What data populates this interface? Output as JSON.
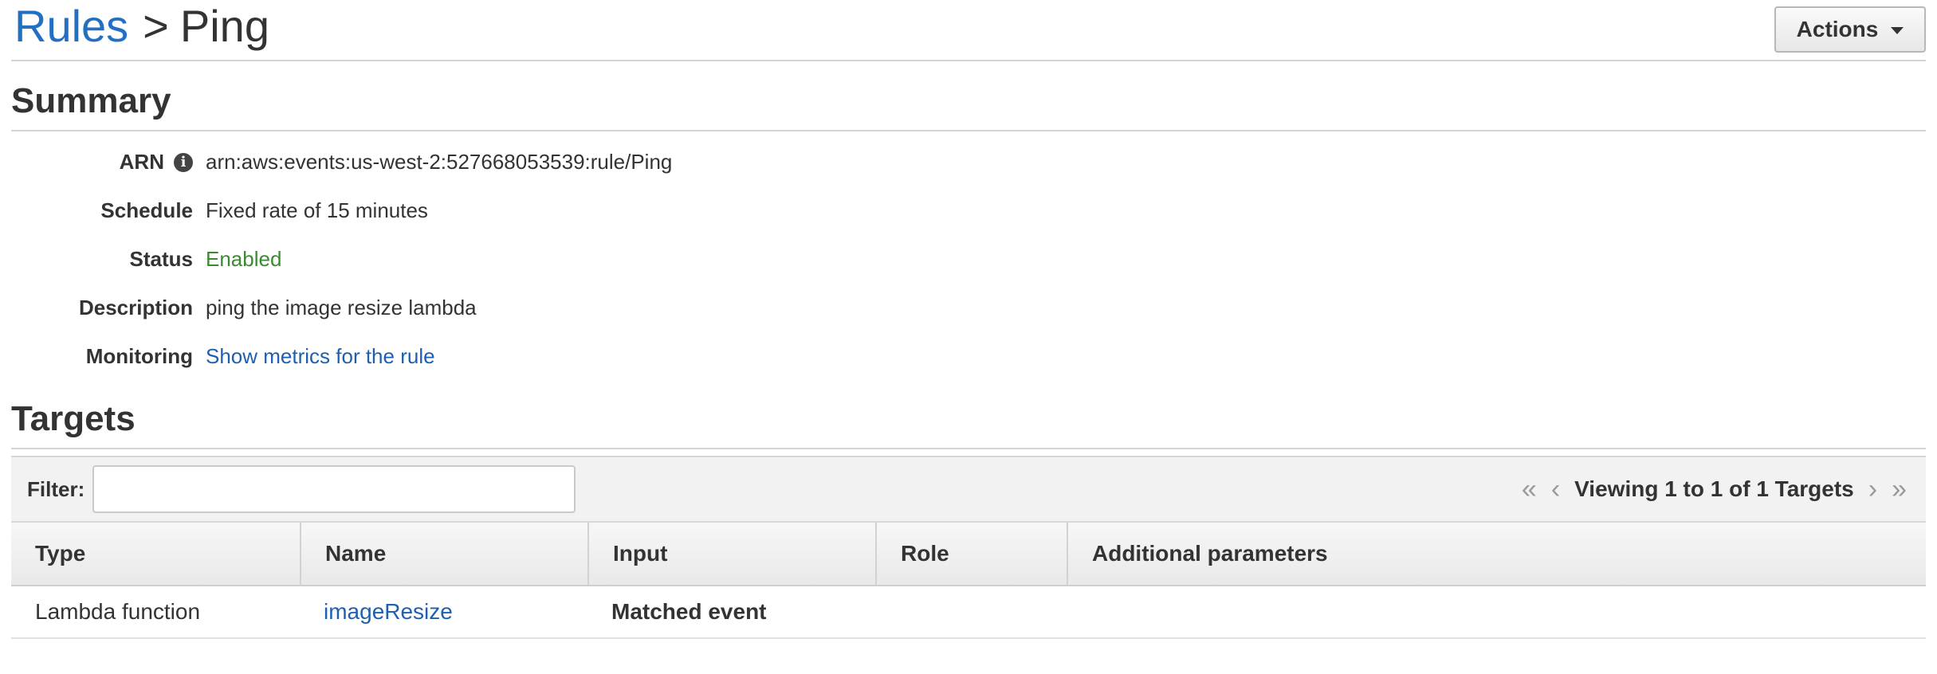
{
  "header": {
    "breadcrumb_root": "Rules",
    "separator": ">",
    "current": "Ping",
    "actions_label": "Actions"
  },
  "summary": {
    "title": "Summary",
    "rows": [
      {
        "label": "ARN",
        "value": "arn:aws:events:us-west-2:527668053539:rule/Ping"
      },
      {
        "label": "Schedule",
        "value": "Fixed rate of 15 minutes"
      },
      {
        "label": "Status",
        "value": "Enabled"
      },
      {
        "label": "Description",
        "value": "ping the image resize lambda"
      },
      {
        "label": "Monitoring",
        "value": "Show metrics for the rule"
      }
    ]
  },
  "targets": {
    "title": "Targets",
    "filter_label": "Filter:",
    "filter_value": "",
    "pager_text": "Viewing 1 to 1 of 1 Targets",
    "columns": [
      "Type",
      "Name",
      "Input",
      "Role",
      "Additional parameters"
    ],
    "rows": [
      {
        "type": "Lambda function",
        "name": "imageResize",
        "input": "Matched event",
        "role": "",
        "additional": ""
      }
    ]
  },
  "icons": {
    "info": "info-icon",
    "first_page": "double-chevron-left-icon",
    "prev_page": "chevron-left-icon",
    "next_page": "chevron-right-icon",
    "last_page": "double-chevron-right-icon",
    "dropdown": "caret-down-icon"
  },
  "colors": {
    "link": "#1f5fb0",
    "breadcrumb_link": "#2270c4",
    "status_enabled": "#3a8b2f"
  }
}
